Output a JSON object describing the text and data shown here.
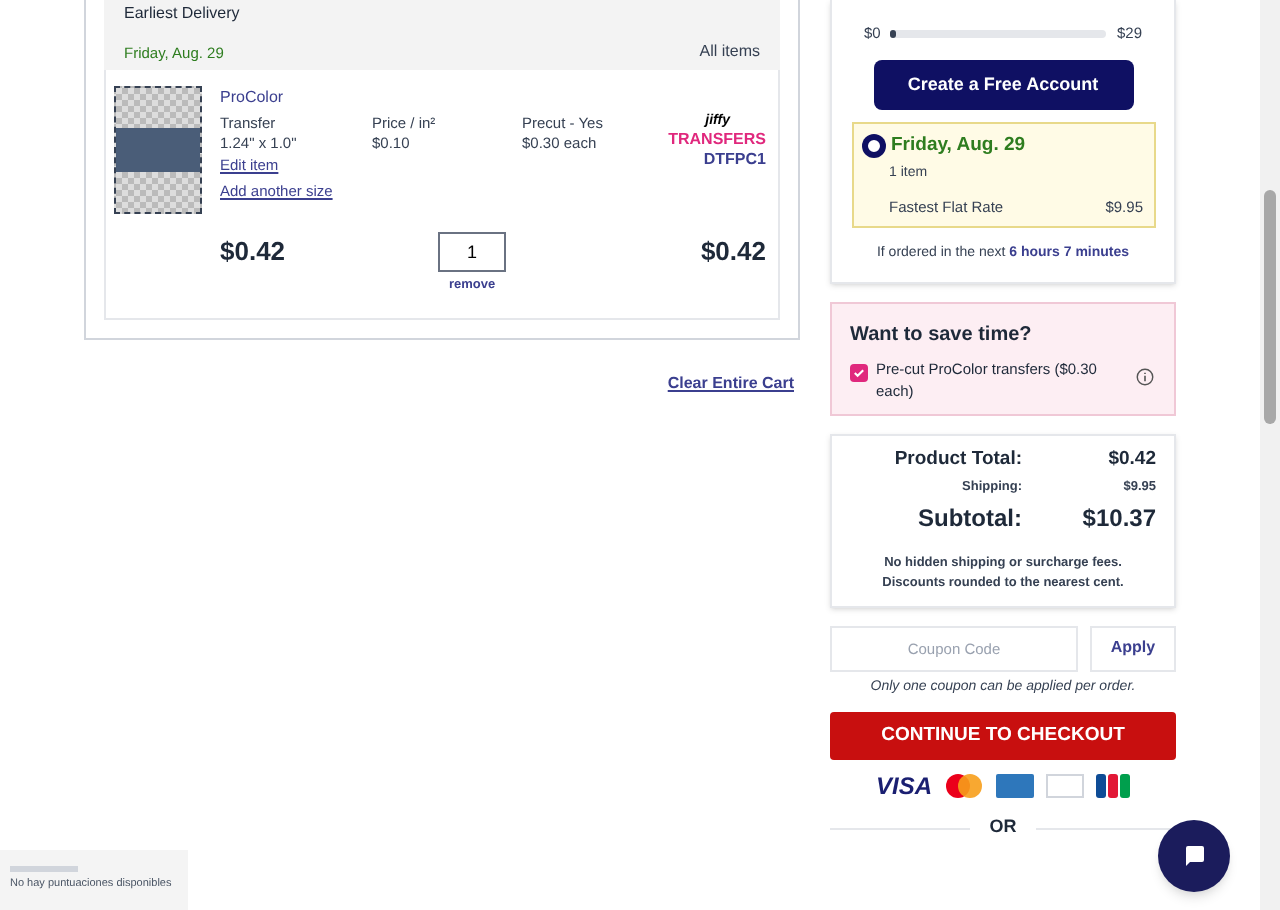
{
  "delivery_header": {
    "title": "Earliest Delivery",
    "date": "Friday, Aug. 29",
    "scope": "All items"
  },
  "cart_item": {
    "name": "ProColor",
    "type": "Transfer",
    "size": "1.24\" x 1.0\"",
    "price_label": "Price / in²",
    "price": "$0.10",
    "precut": "Precut - Yes",
    "precut_price": "$0.30 each",
    "brand_top": "jiffy",
    "brand_bottom": "TRANSFERS",
    "sku": "DTFPC1",
    "edit_link": "Edit item",
    "add_size_link": "Add another size",
    "unit_price": "$0.42",
    "quantity": "1",
    "remove_link": "remove",
    "line_total": "$0.42"
  },
  "clear_cart": "Clear Entire Cart",
  "account_promo": {
    "min": "$0",
    "max": "$29",
    "level": 0.02,
    "button": "Create a Free Account"
  },
  "shipping_option": {
    "selected": true,
    "date": "Friday, Aug. 29",
    "count": "1 item",
    "method": "Fastest Flat Rate",
    "price": "$9.95",
    "note": "If ordered in the next",
    "countdown": "6 hours 7 minutes"
  },
  "precut_box": {
    "title": "Want to save time?",
    "label": "Pre-cut ProColor transfers ($0.30 each)",
    "checked": true
  },
  "totals": {
    "product_label": "Product Total:",
    "product": "$0.42",
    "shipping_label": "Shipping:",
    "shipping": "$9.95",
    "subtotal_label": "Subtotal:",
    "subtotal": "$10.37",
    "note": "No hidden shipping or surcharge fees.",
    "note2": "Discounts rounded to the nearest cent."
  },
  "coupon": {
    "placeholder": "Coupon Code",
    "button": "Apply",
    "note": "Only one coupon can be applied per order."
  },
  "checkout_button": "CONTINUE TO CHECKOUT",
  "payment_cards": [
    {
      "kind": "visa",
      "label": "VISA"
    },
    {
      "kind": "mastercard"
    },
    {
      "kind": "amex"
    },
    {
      "kind": "discover"
    },
    {
      "kind": "jcb"
    }
  ],
  "separator": "OR",
  "reviews_badge": "No hay puntuaciones disponibles"
}
